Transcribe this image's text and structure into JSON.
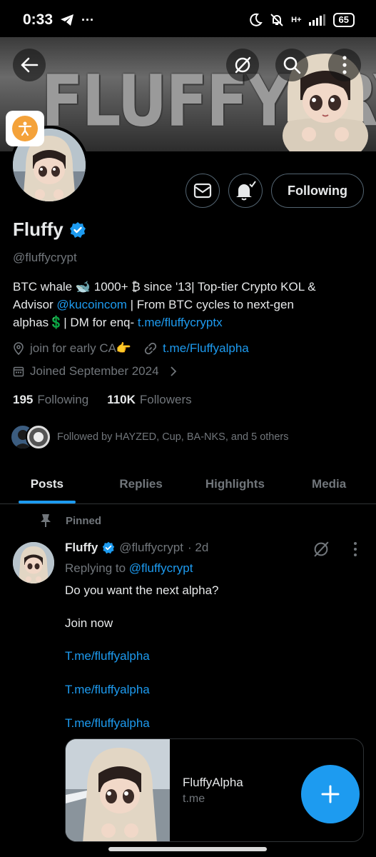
{
  "status_bar": {
    "time": "0:33",
    "network": "H+",
    "battery": "65"
  },
  "banner": {
    "text": "FLUFFYCRYPT"
  },
  "profile": {
    "name": "Fluffy",
    "handle": "@fluffycrypt",
    "bio_1": "BTC whale 🐋 1000+ ₿ since '13| Top-tier Crypto KOL & Advisor ",
    "bio_mention": "@kucoincom",
    "bio_2": " | From BTC cycles to next-gen alphas💲| DM for enq- ",
    "bio_link": "t.me/fluffycryptx",
    "location": "join for early CA👉",
    "website": "t.me/Fluffyalpha",
    "joined": "Joined September 2024",
    "following_count": "195",
    "following_label": "Following",
    "followers_count": "110K",
    "followers_label": "Followers",
    "followed_by": "Followed by HAYZED, Cup, BA-NKS, and 5 others",
    "follow_button": "Following"
  },
  "tabs": [
    {
      "label": "Posts",
      "active": true
    },
    {
      "label": "Replies",
      "active": false
    },
    {
      "label": "Highlights",
      "active": false
    },
    {
      "label": "Media",
      "active": false
    }
  ],
  "tweet": {
    "pinned_label": "Pinned",
    "name": "Fluffy",
    "handle": "@fluffycrypt",
    "time": "· 2d",
    "replying_prefix": "Replying to ",
    "replying_handle": "@fluffycrypt",
    "line_1": "Do you want the next alpha?",
    "line_2": "Join now",
    "link_1": "T.me/fluffyalpha",
    "link_2": "T.me/fluffyalpha",
    "link_3": "T.me/fluffyalpha",
    "card_title": "FluffyAlpha",
    "card_domain": "t.me"
  },
  "colors": {
    "accent": "#1d9bf0",
    "muted": "#71767b",
    "background": "#000000"
  },
  "icons": [
    "back-arrow-icon",
    "grok-icon",
    "search-icon",
    "more-vertical-icon",
    "accessibility-icon",
    "mail-icon",
    "bell-check-icon",
    "verified-badge-icon",
    "location-icon",
    "link-icon",
    "calendar-icon",
    "pin-icon",
    "plus-icon"
  ]
}
